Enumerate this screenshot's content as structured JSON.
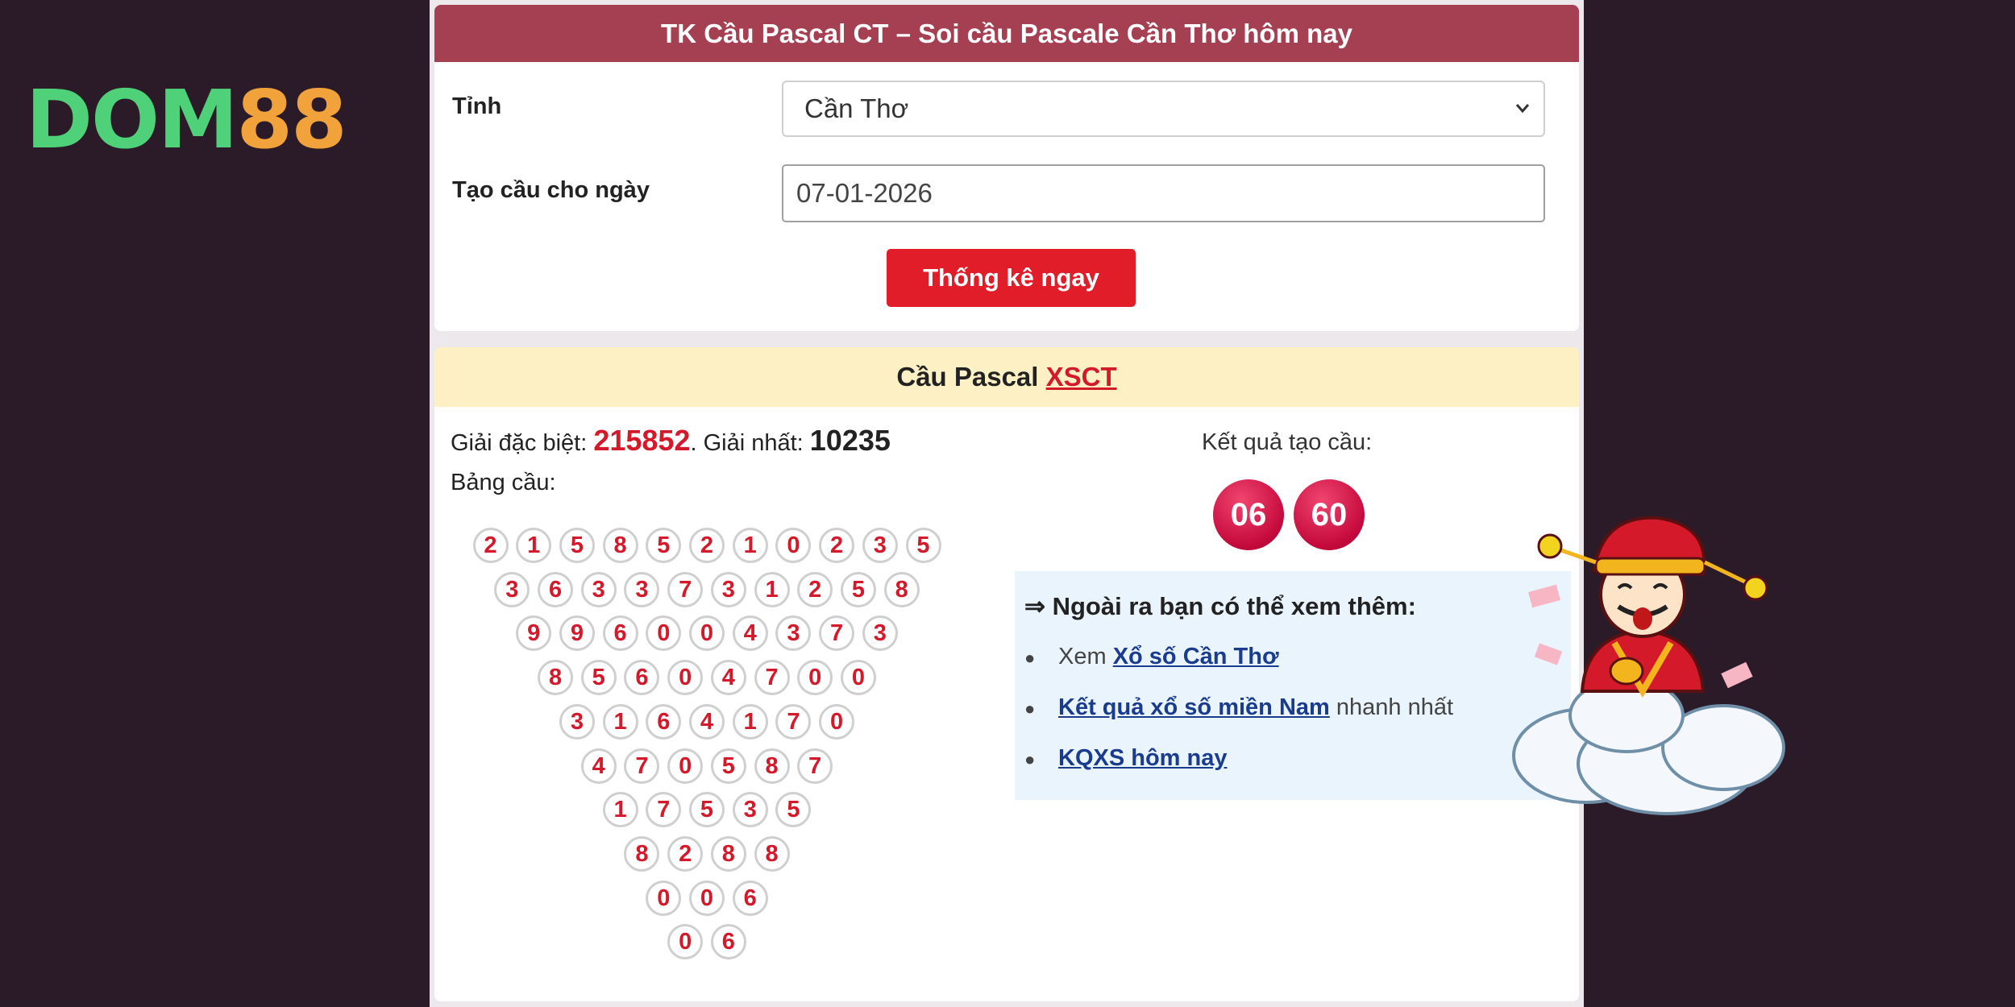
{
  "logo": {
    "part1": "DOM",
    "part2": "88"
  },
  "form": {
    "header": "TK Cầu Pascal CT – Soi cầu Pascale Cần Thơ hôm nay",
    "province_label": "Tỉnh",
    "province_value": "Cần Thơ",
    "date_label": "Tạo cầu cho ngày",
    "date_value": "07-01-2026",
    "submit_label": "Thống kê ngay"
  },
  "result": {
    "header_text": "Cầu Pascal",
    "header_link": "XSCT",
    "special_label": "Giải đặc biệt:",
    "special_value": "215852",
    "first_label": ". Giải nhất:",
    "first_value": "10235",
    "table_label": "Bảng cầu:",
    "result_label": "Kết quả tạo cầu:",
    "result_numbers": [
      "06",
      "60"
    ],
    "triangle": [
      [
        "2",
        "1",
        "5",
        "8",
        "5",
        "2",
        "1",
        "0",
        "2",
        "3",
        "5"
      ],
      [
        "3",
        "6",
        "3",
        "3",
        "7",
        "3",
        "1",
        "2",
        "5",
        "8"
      ],
      [
        "9",
        "9",
        "6",
        "0",
        "0",
        "4",
        "3",
        "7",
        "3"
      ],
      [
        "8",
        "5",
        "6",
        "0",
        "4",
        "7",
        "0",
        "0"
      ],
      [
        "3",
        "1",
        "6",
        "4",
        "1",
        "7",
        "0"
      ],
      [
        "4",
        "7",
        "0",
        "5",
        "8",
        "7"
      ],
      [
        "1",
        "7",
        "5",
        "3",
        "5"
      ],
      [
        "8",
        "2",
        "8",
        "8"
      ],
      [
        "0",
        "0",
        "6"
      ],
      [
        "0",
        "6"
      ]
    ]
  },
  "more": {
    "title": "⇒ Ngoài ra bạn có thể xem thêm:",
    "items": [
      {
        "prefix": "Xem ",
        "link": "Xổ số Cần Thơ",
        "suffix": ""
      },
      {
        "prefix": "",
        "link": "Kết quả xổ số miền Nam",
        "suffix": " nhanh nhất"
      },
      {
        "prefix": "",
        "link": "KQXS hôm nay",
        "suffix": ""
      }
    ]
  },
  "colors": {
    "background": "#2b1b28",
    "header_red": "#a53f52",
    "button_red": "#e11d2a",
    "number_red": "#d3192a",
    "link_blue": "#1a3c8e",
    "logo_green": "#4fd17a",
    "logo_orange": "#f2a23b"
  }
}
